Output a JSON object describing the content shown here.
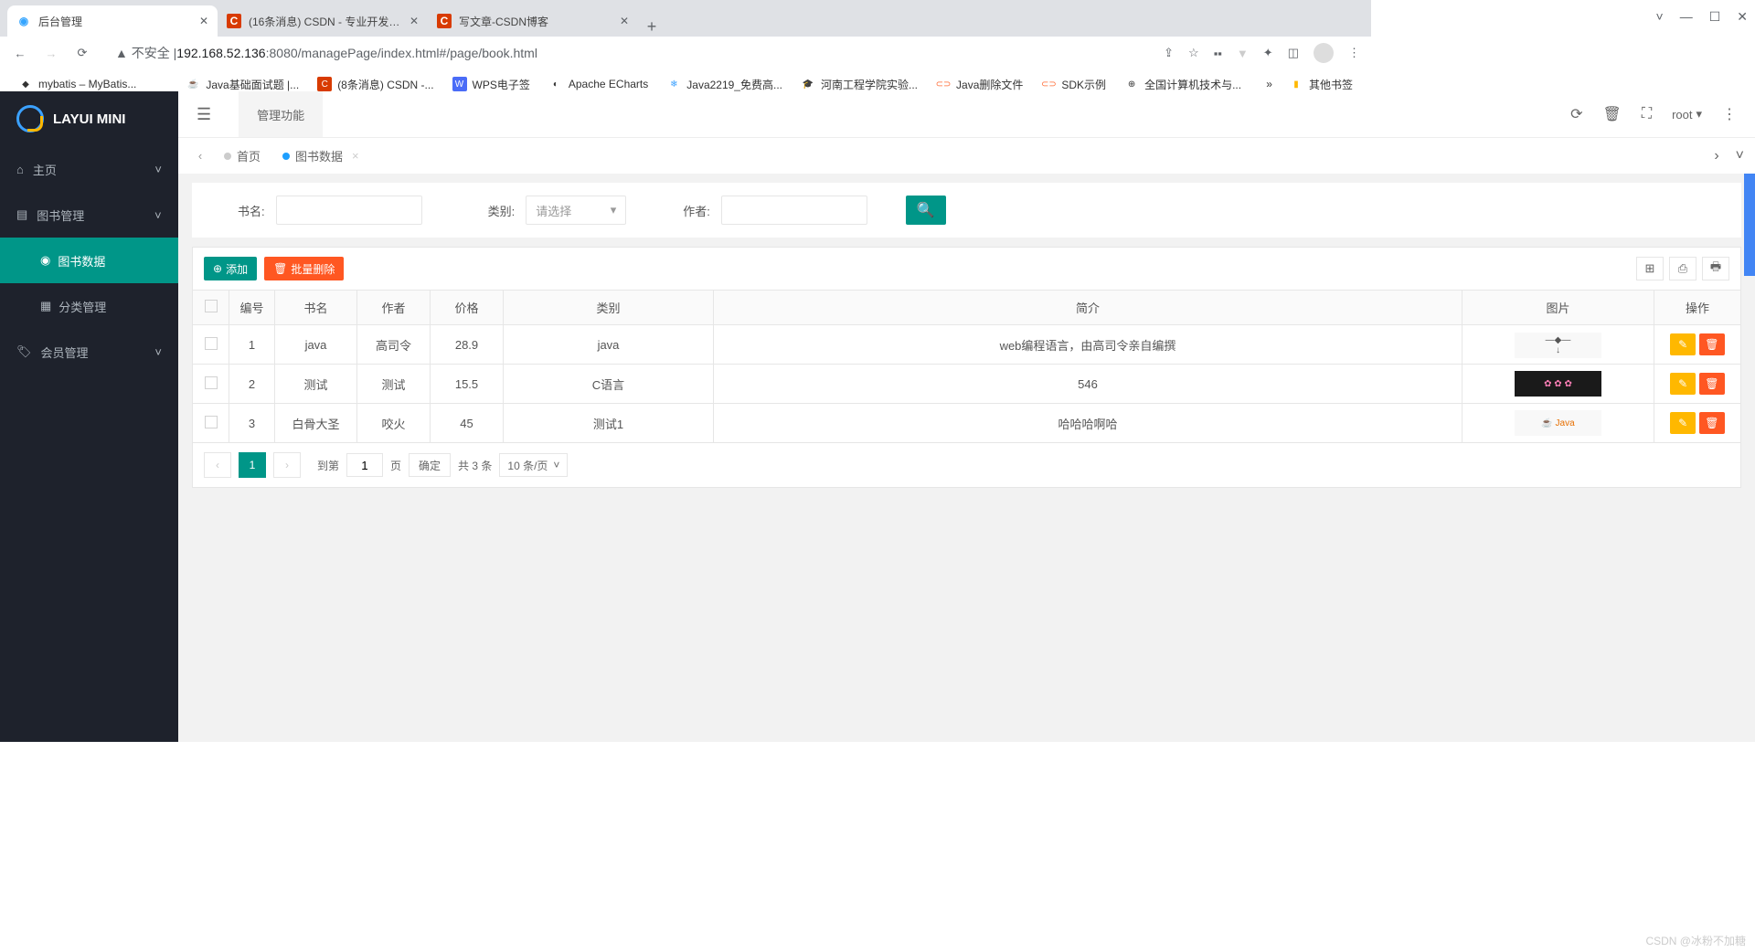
{
  "browser": {
    "tabs": [
      {
        "favicon": "●",
        "title": "后台管理",
        "active": true
      },
      {
        "favicon": "C",
        "title": "(16条消息) CSDN - 专业开发者..."
      },
      {
        "favicon": "C",
        "title": "写文章-CSDN博客"
      }
    ],
    "url_prefix": "▲ 不安全 | ",
    "url_host": "192.168.52.136",
    "url_port": ":8080",
    "url_path": "/managePage/index.html#/page/book.html",
    "window_controls": {
      "min": "—",
      "max": "☐",
      "close": "✕"
    }
  },
  "bookmarks": [
    "mybatis – MyBatis...",
    "Java基础面试题 |...",
    "(8条消息) CSDN -...",
    "WPS电子签",
    "Apache ECharts",
    "Java2219_免费高...",
    "河南工程学院实验...",
    "Java删除文件",
    "SDK示例",
    "全国计算机技术与..."
  ],
  "bookmarks_other": "其他书签",
  "app": {
    "logo": "LAYUI MINI",
    "sidebar": [
      {
        "icon": "⌂",
        "label": "主页",
        "chev": "˅"
      },
      {
        "icon": "▤",
        "label": "图书管理",
        "chev": "˄",
        "open": true,
        "children": [
          {
            "icon": "◉",
            "label": "图书数据",
            "active": true
          },
          {
            "icon": "▦",
            "label": "分类管理"
          }
        ]
      },
      {
        "icon": "🏷",
        "label": "会员管理",
        "chev": "˅"
      }
    ],
    "topbar": {
      "menu_icon": "☰",
      "func_tab": "管理功能",
      "user": "root"
    },
    "tabs": [
      {
        "label": "首页",
        "active": false
      },
      {
        "label": "图书数据",
        "active": true,
        "closable": true
      }
    ],
    "filters": {
      "name_label": "书名:",
      "cat_label": "类别:",
      "cat_placeholder": "请选择",
      "author_label": "作者:"
    },
    "toolbar": {
      "add": "添加",
      "batch_del": "批量删除"
    },
    "columns": [
      "",
      "编号",
      "书名",
      "作者",
      "价格",
      "类别",
      "简介",
      "图片",
      "操作"
    ],
    "rows": [
      {
        "id": "1",
        "name": "java",
        "author": "高司令",
        "price": "28.9",
        "cat": "java",
        "desc": "web编程语言，由高司令亲自编撰",
        "img": "diag"
      },
      {
        "id": "2",
        "name": "测试",
        "author": "测试",
        "price": "15.5",
        "cat": "C语言",
        "desc": "546",
        "img": "dark"
      },
      {
        "id": "3",
        "name": "白骨大圣",
        "author": "咬火",
        "price": "45",
        "cat": "测试1",
        "desc": "哈哈哈啊哈",
        "img": "java"
      }
    ],
    "pager": {
      "page": "1",
      "goto_label": "到第",
      "goto_val": "1",
      "page_label": "页",
      "confirm": "确定",
      "total": "共 3 条",
      "per_page": "10 条/页"
    }
  },
  "watermark": "CSDN @冰粉不加糖"
}
